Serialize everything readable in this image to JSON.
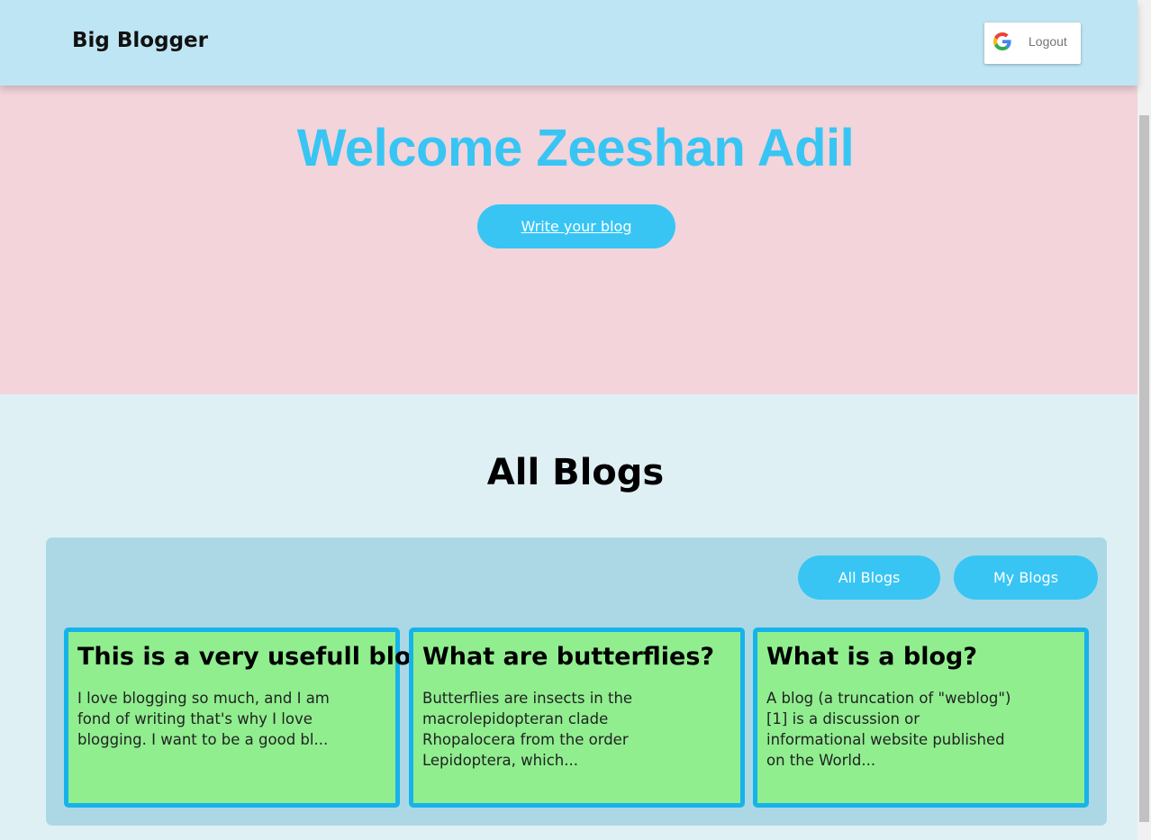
{
  "navbar": {
    "brand": "Big Blogger",
    "logout_label": "Logout",
    "logout_icon": "google-g-icon"
  },
  "hero": {
    "welcome": "Welcome Zeeshan Adil",
    "write_button": "Write your blog"
  },
  "blogs": {
    "title": "All Blogs",
    "filters": {
      "all_label": "All Blogs",
      "mine_label": "My Blogs"
    },
    "cards": [
      {
        "title": "This is a very usefull blog",
        "excerpt": "I love blogging so much, and I am fond of writing that's why I love blogging. I want to be a good bl..."
      },
      {
        "title": "What are butterflies?",
        "excerpt": "Butterflies are insects in the macrolepidopteran clade Rhopalocera from the order Lepidoptera, which..."
      },
      {
        "title": "What is a blog?",
        "excerpt": "A blog (a truncation of \"weblog\")[1] is a discussion or informational website published on the World..."
      }
    ]
  },
  "colors": {
    "navbar": "#bee5f4",
    "hero": "#f2d4da",
    "accent": "#38c5f4",
    "card": "#90ee8f",
    "card_border": "#16b3eb",
    "panel": "#acd8e5",
    "page": "#dff0f5"
  }
}
